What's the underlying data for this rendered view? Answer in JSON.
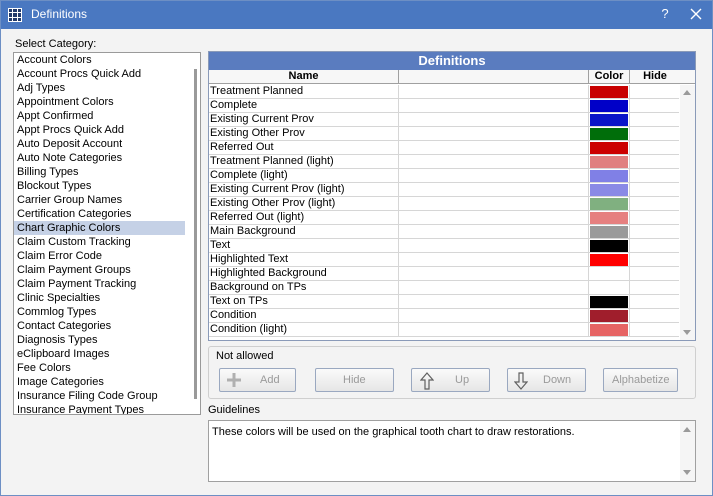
{
  "window": {
    "title": "Definitions",
    "help_label": "?"
  },
  "category": {
    "label": "Select Category:",
    "items": [
      "Account Colors",
      "Account Procs Quick Add",
      "Adj Types",
      "Appointment Colors",
      "Appt Confirmed",
      "Appt Procs Quick Add",
      "Auto Deposit Account",
      "Auto Note Categories",
      "Billing Types",
      "Blockout Types",
      "Carrier Group Names",
      "Certification Categories",
      "Chart Graphic Colors",
      "Claim Custom Tracking",
      "Claim Error Code",
      "Claim Payment Groups",
      "Claim Payment Tracking",
      "Clinic Specialties",
      "Commlog Types",
      "Contact Categories",
      "Diagnosis Types",
      "eClipboard Images",
      "Fee Colors",
      "Image Categories",
      "Insurance Filing Code Group",
      "Insurance Payment Types"
    ],
    "selected_index": 12
  },
  "grid": {
    "title": "Definitions",
    "columns": {
      "name": "Name",
      "value": "",
      "color": "Color",
      "hide": "Hide"
    },
    "rows": [
      {
        "name": "Treatment Planned",
        "color": "#c80000"
      },
      {
        "name": "Complete",
        "color": "#0000c8"
      },
      {
        "name": "Existing Current Prov",
        "color": "#0a14c8"
      },
      {
        "name": "Existing Other Prov",
        "color": "#006e0a"
      },
      {
        "name": "Referred Out",
        "color": "#cc0000"
      },
      {
        "name": "Treatment Planned (light)",
        "color": "#e08080"
      },
      {
        "name": "Complete (light)",
        "color": "#8080e6"
      },
      {
        "name": "Existing Current Prov (light)",
        "color": "#8a8ae6"
      },
      {
        "name": "Existing Other Prov (light)",
        "color": "#80b080"
      },
      {
        "name": "Referred Out (light)",
        "color": "#e68080"
      },
      {
        "name": "Main Background",
        "color": "#9a9a9a"
      },
      {
        "name": "Text",
        "color": "#000000"
      },
      {
        "name": "Highlighted Text",
        "color": "#ff0000"
      },
      {
        "name": "Highlighted Background",
        "color": "#ffffff"
      },
      {
        "name": "Background on TPs",
        "color": "#ffffff"
      },
      {
        "name": "Text on TPs",
        "color": "#000000"
      },
      {
        "name": "Condition",
        "color": "#a01e2c"
      },
      {
        "name": "Condition (light)",
        "color": "#e66464"
      }
    ]
  },
  "actions": {
    "message": "Not allowed",
    "add": "Add",
    "hide": "Hide",
    "up": "Up",
    "down": "Down",
    "alphabetize": "Alphabetize"
  },
  "guidelines": {
    "label": "Guidelines",
    "text": "These colors will be used on the graphical tooth chart to draw restorations."
  }
}
